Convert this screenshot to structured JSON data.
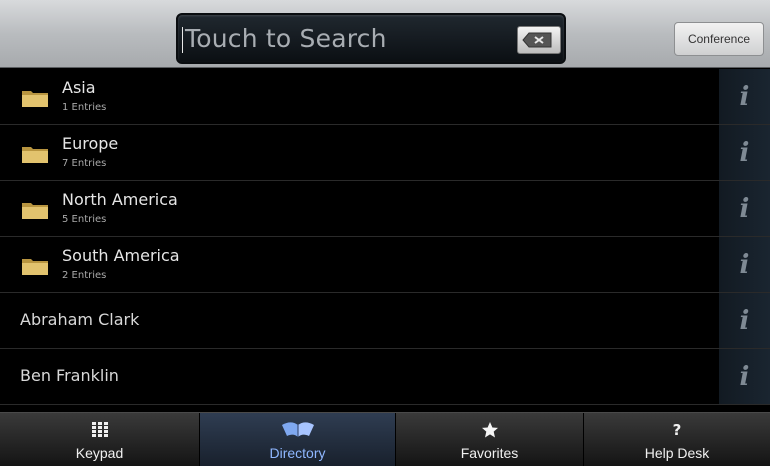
{
  "header": {
    "search_placeholder": "Touch to Search",
    "conference_label": "Conference"
  },
  "list": {
    "folders": [
      {
        "title": "Asia",
        "subtitle": "1 Entries"
      },
      {
        "title": "Europe",
        "subtitle": "7 Entries"
      },
      {
        "title": "North America",
        "subtitle": "5 Entries"
      },
      {
        "title": "South America",
        "subtitle": "2 Entries"
      }
    ],
    "contacts": [
      {
        "name": "Abraham Clark"
      },
      {
        "name": "Ben Franklin"
      }
    ],
    "info_glyph": "i",
    "folder_icon": "folder-icon"
  },
  "nav": {
    "items": [
      {
        "label": "Keypad",
        "icon": "keypad-icon",
        "active": false
      },
      {
        "label": "Directory",
        "icon": "directory-icon",
        "active": true
      },
      {
        "label": "Favorites",
        "icon": "star-icon",
        "active": false
      },
      {
        "label": "Help Desk",
        "icon": "help-icon",
        "glyph": "?",
        "active": false
      }
    ]
  },
  "colors": {
    "header_bg": "#b9bcbf",
    "list_bg": "#000000",
    "active_tab_text": "#8fb7ff",
    "folder": "#d9b85e"
  }
}
